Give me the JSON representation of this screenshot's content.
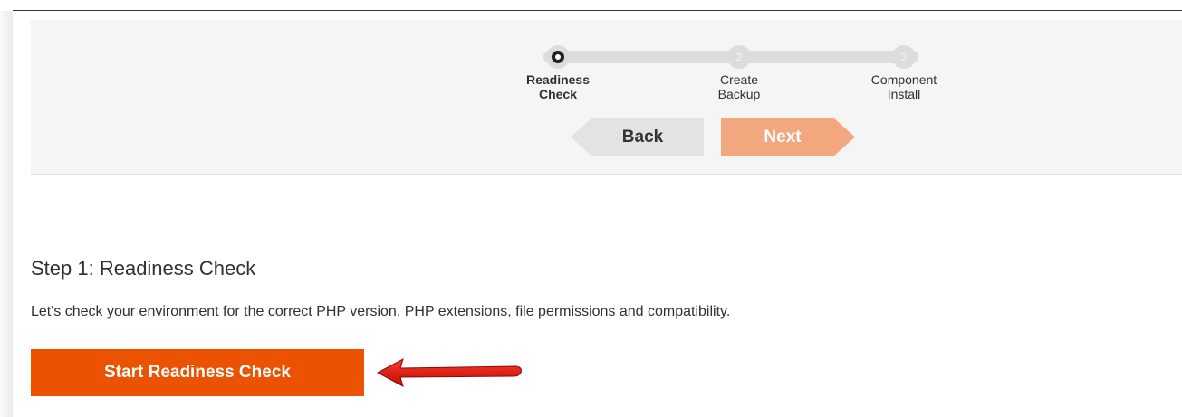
{
  "wizard": {
    "steps": [
      {
        "number": "1",
        "label_line1": "Readiness",
        "label_line2": "Check",
        "state": "active"
      },
      {
        "number": "2",
        "label_line1": "Create",
        "label_line2": "Backup",
        "state": "pending"
      },
      {
        "number": "3",
        "label_line1": "Component",
        "label_line2": "Install",
        "state": "pending"
      }
    ],
    "back_label": "Back",
    "next_label": "Next"
  },
  "main": {
    "title": "Step 1: Readiness Check",
    "description": "Let's check your environment for the correct PHP version, PHP extensions, file permissions and compatibility.",
    "start_button_label": "Start Readiness Check"
  },
  "annotation": {
    "arrow_color": "#e0140b",
    "arrow_icon": "red-arrow-left-icon"
  },
  "colors": {
    "accent": "#eb5202",
    "next_disabled": "#f3a77f",
    "panel_bg": "#f5f5f5"
  }
}
